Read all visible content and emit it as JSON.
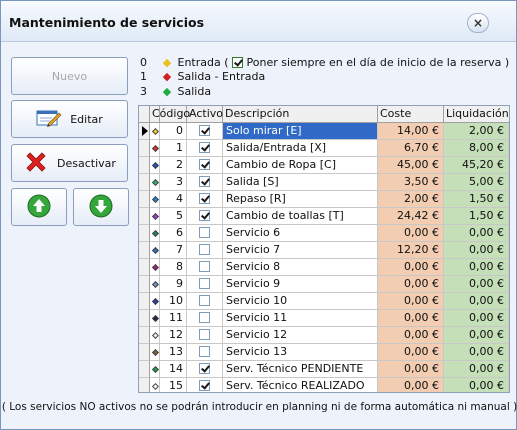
{
  "window": {
    "title": "Mantenimiento de servicios",
    "close_glyph": "×"
  },
  "buttons": {
    "nuevo": "Nuevo",
    "editar": "Editar",
    "desactivar": "Desactivar"
  },
  "legend": [
    {
      "num": "0",
      "color": "#e8c020",
      "label": "Entrada ("
    },
    {
      "num": "1",
      "color": "#cc2222",
      "label": "Salida - Entrada"
    },
    {
      "num": "3",
      "color": "#22aa44",
      "label": "Salida"
    }
  ],
  "legend_option": {
    "label": "Poner siempre en el día de inicio de la reserva )",
    "checked": true
  },
  "table": {
    "headers": [
      "Código",
      "Activo",
      "Descripción",
      "Coste",
      "Liquidación"
    ],
    "rows": [
      {
        "codigo": "0",
        "activo": true,
        "descripcion": "Solo mirar [E]",
        "coste": "14,00 €",
        "liquidacion": "2,00 €",
        "dot": "#f2d040",
        "selected": true
      },
      {
        "codigo": "1",
        "activo": true,
        "descripcion": "Salida/Entrada [X]",
        "coste": "6,70 €",
        "liquidacion": "8,00 €",
        "dot": "#d03030"
      },
      {
        "codigo": "2",
        "activo": true,
        "descripcion": "Cambio de Ropa [C]",
        "coste": "45,00 €",
        "liquidacion": "45,20 €",
        "dot": "#2050c0"
      },
      {
        "codigo": "3",
        "activo": true,
        "descripcion": "Salida [S]",
        "coste": "3,50 €",
        "liquidacion": "5,00 €",
        "dot": "#30b070"
      },
      {
        "codigo": "4",
        "activo": true,
        "descripcion": "Repaso [R]",
        "coste": "2,00 €",
        "liquidacion": "1,50 €",
        "dot": "#2080e0"
      },
      {
        "codigo": "5",
        "activo": true,
        "descripcion": "Cambio de toallas [T]",
        "coste": "24,42 €",
        "liquidacion": "1,50 €",
        "dot": "#a040c0"
      },
      {
        "codigo": "6",
        "activo": false,
        "descripcion": "Servicio 6",
        "coste": "0,00 €",
        "liquidacion": "0,00 €",
        "dot": "#208060"
      },
      {
        "codigo": "7",
        "activo": false,
        "descripcion": "Servicio 7",
        "coste": "12,20 €",
        "liquidacion": "0,00 €",
        "dot": "#3070c0"
      },
      {
        "codigo": "8",
        "activo": false,
        "descripcion": "Servicio 8",
        "coste": "0,00 €",
        "liquidacion": "0,00 €",
        "dot": "#a02080"
      },
      {
        "codigo": "9",
        "activo": false,
        "descripcion": "Servicio 9",
        "coste": "0,00 €",
        "liquidacion": "0,00 €",
        "dot": "#7090c0"
      },
      {
        "codigo": "10",
        "activo": false,
        "descripcion": "Servicio 10",
        "coste": "0,00 €",
        "liquidacion": "0,00 €",
        "dot": "#2040a0"
      },
      {
        "codigo": "11",
        "activo": false,
        "descripcion": "Servicio 11",
        "coste": "0,00 €",
        "liquidacion": "0,00 €",
        "dot": "#202040"
      },
      {
        "codigo": "12",
        "activo": false,
        "descripcion": "Servicio 12",
        "coste": "0,00 €",
        "liquidacion": "0,00 €",
        "dot": "#f0f0f0"
      },
      {
        "codigo": "13",
        "activo": false,
        "descripcion": "Servicio 13",
        "coste": "0,00 €",
        "liquidacion": "0,00 €",
        "dot": "#806030"
      },
      {
        "codigo": "14",
        "activo": true,
        "descripcion": "Serv. Técnico PENDIENTE",
        "coste": "0,00 €",
        "liquidacion": "0,00 €",
        "dot": "#20a040"
      },
      {
        "codigo": "15",
        "activo": true,
        "descripcion": "Serv. Técnico REALIZADO",
        "coste": "0,00 €",
        "liquidacion": "0,00 €",
        "dot": "#f8f8f8"
      }
    ]
  },
  "footer": "( Los servicios NO activos no se podrán introducir en   planning ni de forma automática ni manual )"
}
